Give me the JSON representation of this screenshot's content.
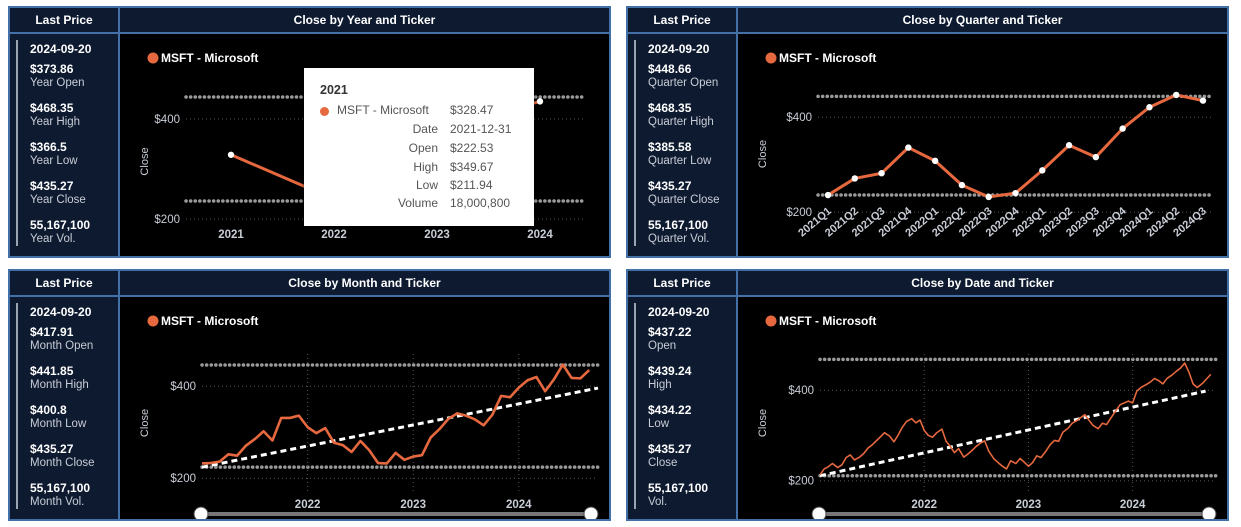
{
  "accent": "#e5683f",
  "panels": [
    {
      "left_title": "Last Price",
      "chart_title": "Close by Year and Ticker",
      "date": "2024-09-20",
      "stats": [
        {
          "value": "$373.86",
          "label": "Year Open"
        },
        {
          "value": "$468.35",
          "label": "Year High"
        },
        {
          "value": "$366.5",
          "label": "Year Low"
        },
        {
          "value": "$435.27",
          "label": "Year Close"
        },
        {
          "value": "55,167,100",
          "label": "Year Vol."
        }
      ]
    },
    {
      "left_title": "Last Price",
      "chart_title": "Close by Quarter and Ticker",
      "date": "2024-09-20",
      "stats": [
        {
          "value": "$448.66",
          "label": "Quarter Open"
        },
        {
          "value": "$468.35",
          "label": "Quarter High"
        },
        {
          "value": "$385.58",
          "label": "Quarter Low"
        },
        {
          "value": "$435.27",
          "label": "Quarter Close"
        },
        {
          "value": "55,167,100",
          "label": "Quarter Vol."
        }
      ]
    },
    {
      "left_title": "Last Price",
      "chart_title": "Close by Month and Ticker",
      "date": "2024-09-20",
      "stats": [
        {
          "value": "$417.91",
          "label": "Month Open"
        },
        {
          "value": "$441.85",
          "label": "Month High"
        },
        {
          "value": "$400.8",
          "label": "Month Low"
        },
        {
          "value": "$435.27",
          "label": "Month Close"
        },
        {
          "value": "55,167,100",
          "label": "Month Vol."
        }
      ]
    },
    {
      "left_title": "Last Price",
      "chart_title": "Close by Date and Ticker",
      "date": "2024-09-20",
      "stats": [
        {
          "value": "$437.22",
          "label": "Open"
        },
        {
          "value": "$439.24",
          "label": "High"
        },
        {
          "value": "$434.22",
          "label": "Low"
        },
        {
          "value": "$435.27",
          "label": "Close"
        },
        {
          "value": "55,167,100",
          "label": "Vol."
        }
      ]
    }
  ],
  "tooltip": {
    "title": "2021",
    "series": "MSFT - Microsoft",
    "series_value": "$328.47",
    "rows": [
      {
        "key": "Date",
        "value": "2021-12-31"
      },
      {
        "key": "Open",
        "value": "$222.53"
      },
      {
        "key": "High",
        "value": "$349.67"
      },
      {
        "key": "Low",
        "value": "$211.94"
      },
      {
        "key": "Volume",
        "value": "18,000,800"
      }
    ]
  },
  "chart_data": [
    {
      "type": "line",
      "title": "Close by Year and Ticker",
      "legend": "MSFT - Microsoft",
      "legend_position": "top-left",
      "ylabel": "Close",
      "ylim": [
        170,
        460
      ],
      "yticks": [
        {
          "value": 400,
          "label": "$400"
        },
        {
          "value": 200,
          "label": "$200"
        }
      ],
      "ref_lines": [
        444,
        236
      ],
      "x": [
        "2021",
        "2022",
        "2023",
        "2024"
      ],
      "xtick_labels": [
        "2021",
        "2022",
        "2023",
        "2024"
      ],
      "series": [
        {
          "name": "MSFT - Microsoft",
          "values": [
            328.47,
            239.8,
            376.0,
            435.27
          ]
        }
      ]
    },
    {
      "type": "line",
      "title": "Close by Quarter and Ticker",
      "legend": "MSFT - Microsoft",
      "legend_position": "top-left",
      "ylabel": "Close",
      "ylim": [
        175,
        470
      ],
      "yticks": [
        {
          "value": 400,
          "label": "$400"
        },
        {
          "value": 200,
          "label": "$200"
        }
      ],
      "ref_lines": [
        444,
        236
      ],
      "x": [
        "2021Q1",
        "2021Q2",
        "2021Q3",
        "2021Q4",
        "2022Q1",
        "2022Q2",
        "2022Q3",
        "2022Q4",
        "2023Q1",
        "2023Q2",
        "2023Q3",
        "2023Q4",
        "2024Q1",
        "2024Q2",
        "2024Q3"
      ],
      "xtick_labels": [
        "2021Q1",
        "2021Q2",
        "2021Q3",
        "2021Q4",
        "2022Q1",
        "2022Q2",
        "2022Q3",
        "2022Q4",
        "2023Q1",
        "2023Q2",
        "2023Q3",
        "2023Q4",
        "2024Q1",
        "2024Q2",
        "2024Q3"
      ],
      "series": [
        {
          "name": "MSFT - Microsoft",
          "values": [
            236,
            271,
            282,
            336,
            308,
            257,
            232,
            240,
            288,
            341,
            316,
            376,
            421,
            447,
            435
          ]
        }
      ]
    },
    {
      "type": "line",
      "title": "Close by Month and Ticker",
      "legend": "MSFT - Microsoft",
      "legend_position": "top-left",
      "ylabel": "Close",
      "ylim": [
        170,
        470
      ],
      "yticks": [
        {
          "value": 400,
          "label": "$400"
        },
        {
          "value": 200,
          "label": "$200"
        }
      ],
      "ref_lines": [
        446,
        224
      ],
      "x_domain": [
        2021.0,
        2024.75
      ],
      "xtick_labels": [
        {
          "value": 2022,
          "label": "2022"
        },
        {
          "value": 2023,
          "label": "2023"
        },
        {
          "value": 2024,
          "label": "2024"
        }
      ],
      "x": [
        2021.0,
        2021.083,
        2021.167,
        2021.25,
        2021.333,
        2021.417,
        2021.5,
        2021.583,
        2021.667,
        2021.75,
        2021.833,
        2021.917,
        2022.0,
        2022.083,
        2022.167,
        2022.25,
        2022.333,
        2022.417,
        2022.5,
        2022.583,
        2022.667,
        2022.75,
        2022.833,
        2022.917,
        2023.0,
        2023.083,
        2023.167,
        2023.25,
        2023.333,
        2023.417,
        2023.5,
        2023.583,
        2023.667,
        2023.75,
        2023.833,
        2023.917,
        2024.0,
        2024.083,
        2024.167,
        2024.25,
        2024.333,
        2024.417,
        2024.5,
        2024.583,
        2024.667
      ],
      "series": [
        {
          "name": "MSFT - Microsoft",
          "values": [
            232,
            233,
            236,
            252,
            249,
            271,
            285,
            302,
            282,
            331,
            331,
            336,
            311,
            298,
            309,
            277,
            272,
            257,
            281,
            261,
            233,
            232,
            255,
            240,
            247,
            250,
            289,
            307,
            329,
            341,
            336,
            328,
            315,
            338,
            379,
            376,
            397,
            413,
            420,
            389,
            415,
            447,
            418,
            417,
            435
          ]
        },
        {
          "name": "trend",
          "values": [
            224,
            396
          ]
        }
      ],
      "trend_x": [
        2021.0,
        2024.75
      ],
      "range_slider": true
    },
    {
      "type": "line",
      "title": "Close by Date and Ticker",
      "legend": "MSFT - Microsoft",
      "legend_position": "top-left",
      "ylabel": "Close",
      "ylim": [
        175,
        480
      ],
      "yticks": [
        {
          "value": 400,
          "label": "$400"
        },
        {
          "value": 200,
          "label": "$200"
        }
      ],
      "ref_lines": [
        468,
        211
      ],
      "x_domain": [
        2021.0,
        2024.8
      ],
      "xtick_labels": [
        {
          "value": 2022,
          "label": "2022"
        },
        {
          "value": 2023,
          "label": "2023"
        },
        {
          "value": 2024,
          "label": "2024"
        }
      ],
      "x": [
        2021.0,
        2021.04,
        2021.08,
        2021.12,
        2021.17,
        2021.21,
        2021.25,
        2021.29,
        2021.33,
        2021.38,
        2021.42,
        2021.46,
        2021.5,
        2021.54,
        2021.58,
        2021.62,
        2021.67,
        2021.71,
        2021.75,
        2021.79,
        2021.83,
        2021.88,
        2021.92,
        2021.96,
        2022.0,
        2022.04,
        2022.08,
        2022.12,
        2022.17,
        2022.21,
        2022.25,
        2022.29,
        2022.33,
        2022.38,
        2022.42,
        2022.46,
        2022.5,
        2022.54,
        2022.58,
        2022.62,
        2022.67,
        2022.71,
        2022.75,
        2022.79,
        2022.83,
        2022.88,
        2022.92,
        2022.96,
        2023.0,
        2023.04,
        2023.08,
        2023.12,
        2023.17,
        2023.21,
        2023.25,
        2023.29,
        2023.33,
        2023.38,
        2023.42,
        2023.46,
        2023.5,
        2023.54,
        2023.58,
        2023.62,
        2023.67,
        2023.71,
        2023.75,
        2023.79,
        2023.83,
        2023.88,
        2023.92,
        2023.96,
        2024.0,
        2024.04,
        2024.08,
        2024.12,
        2024.17,
        2024.21,
        2024.25,
        2024.29,
        2024.33,
        2024.38,
        2024.42,
        2024.46,
        2024.5,
        2024.54,
        2024.58,
        2024.62,
        2024.67,
        2024.71,
        2024.75
      ],
      "series": [
        {
          "name": "MSFT - Microsoft",
          "values": [
            213,
            226,
            231,
            238,
            229,
            235,
            251,
            257,
            246,
            252,
            260,
            272,
            279,
            288,
            297,
            306,
            298,
            286,
            301,
            318,
            331,
            337,
            328,
            334,
            311,
            300,
            296,
            306,
            314,
            287,
            276,
            262,
            271,
            252,
            259,
            267,
            276,
            283,
            288,
            265,
            248,
            240,
            232,
            226,
            244,
            238,
            249,
            241,
            232,
            240,
            255,
            251,
            266,
            280,
            289,
            287,
            307,
            316,
            327,
            332,
            339,
            346,
            334,
            322,
            315,
            327,
            324,
            338,
            352,
            368,
            372,
            376,
            372,
            398,
            406,
            411,
            418,
            426,
            421,
            414,
            426,
            434,
            442,
            449,
            460,
            440,
            414,
            406,
            415,
            425,
            435
          ]
        },
        {
          "name": "trend",
          "values": [
            211,
            398
          ]
        }
      ],
      "trend_x": [
        2021.0,
        2024.7
      ],
      "range_slider": true
    }
  ]
}
